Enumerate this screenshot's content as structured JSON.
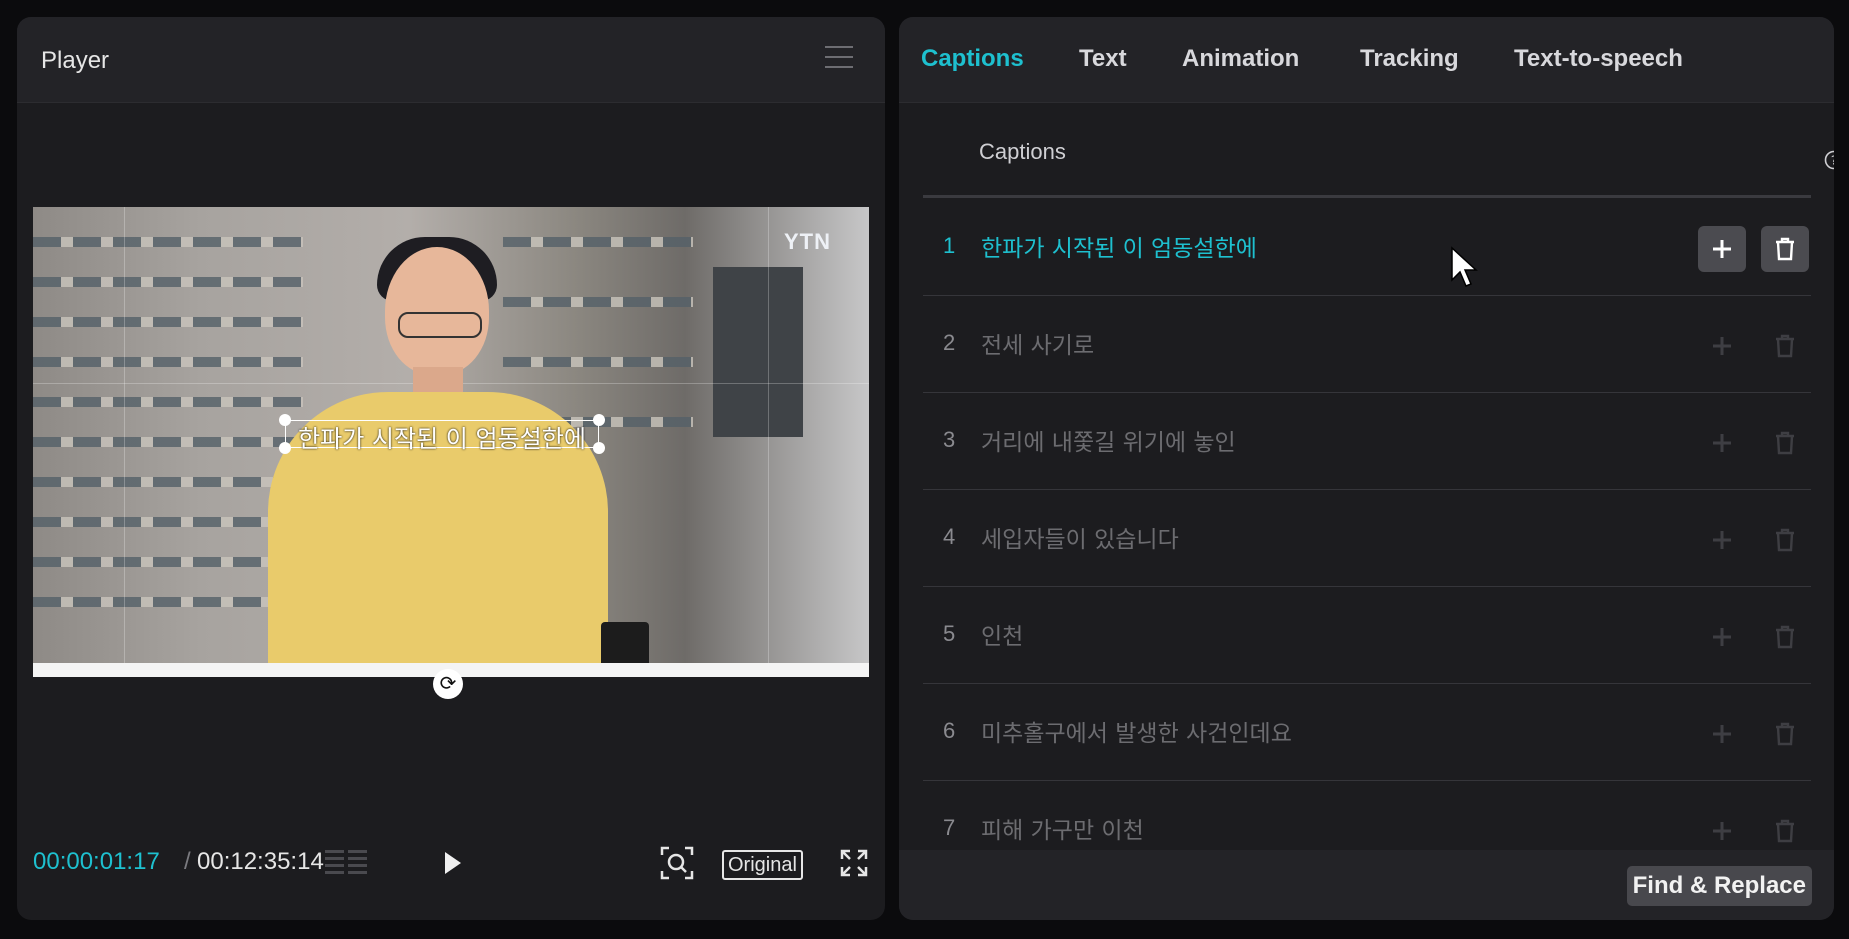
{
  "player": {
    "title": "Player",
    "video": {
      "channel_logo": "YTN",
      "subtitle_overlay": "한파가 시작된 이 엄동설한에"
    },
    "controls": {
      "current_time": "00:00:01:17",
      "separator": "/",
      "total_time": "00:12:35:14",
      "original_label": "Original"
    }
  },
  "panel": {
    "tabs": [
      {
        "label": "Captions",
        "active": true
      },
      {
        "label": "Text",
        "active": false
      },
      {
        "label": "Animation",
        "active": false
      },
      {
        "label": "Tracking",
        "active": false
      },
      {
        "label": "Text-to-speech",
        "active": false
      }
    ],
    "section_title": "Captions",
    "captions": [
      {
        "index": "1",
        "text": "한파가 시작된 이 엄동설한에",
        "active": true
      },
      {
        "index": "2",
        "text": "전세 사기로",
        "active": false
      },
      {
        "index": "3",
        "text": "거리에 내쫓길 위기에 놓인",
        "active": false
      },
      {
        "index": "4",
        "text": "세입자들이 있습니다",
        "active": false
      },
      {
        "index": "5",
        "text": "인천",
        "active": false
      },
      {
        "index": "6",
        "text": "미추홀구에서 발생한 사건인데요",
        "active": false
      },
      {
        "index": "7",
        "text": "피해 가구만 이천",
        "active": false
      }
    ],
    "find_replace_label": "Find & Replace"
  },
  "colors": {
    "accent": "#1ec0cf",
    "panel_bg": "#1c1c1f",
    "header_bg": "#232327"
  },
  "icons": [
    "menu-icon",
    "play-icon",
    "zoom-fit-icon",
    "fullscreen-icon",
    "frames-icon",
    "help-icon",
    "plus-icon",
    "trash-icon",
    "rotate-icon",
    "mouse-cursor-icon"
  ]
}
